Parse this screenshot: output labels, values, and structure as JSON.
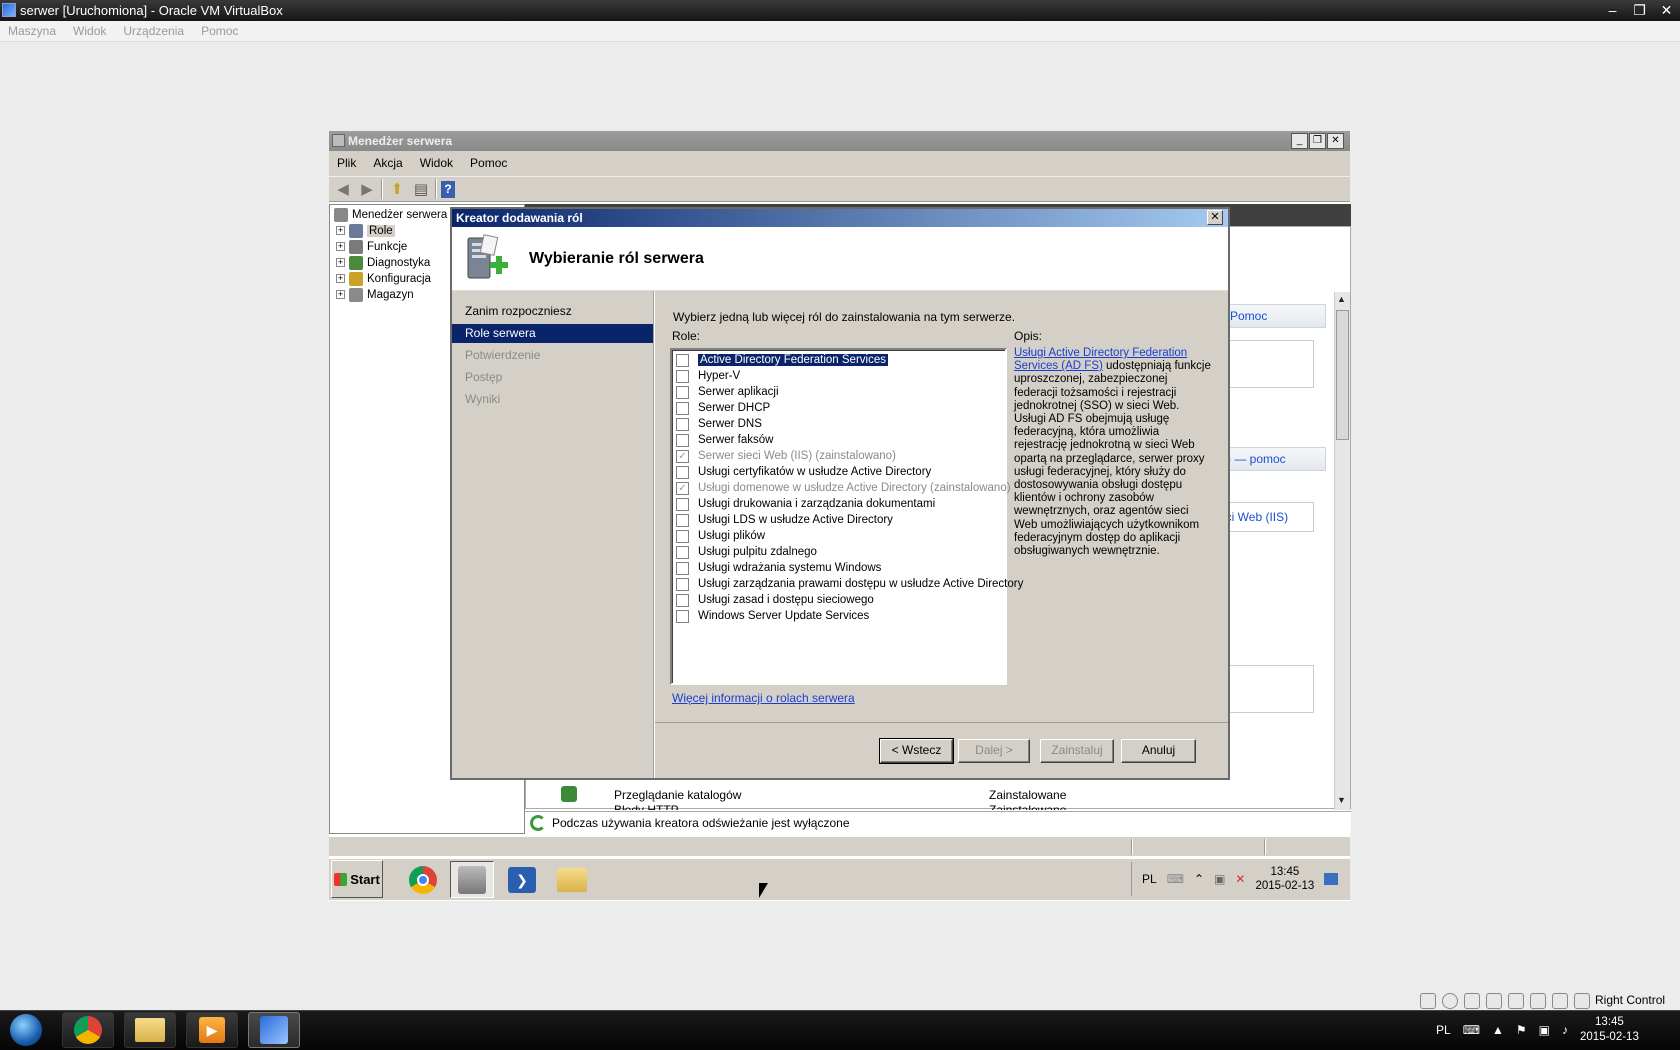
{
  "host": {
    "title": "serwer [Uruchomiona] - Oracle VM VirtualBox",
    "menu": [
      "Maszyna",
      "Widok",
      "Urządzenia",
      "Pomoc"
    ],
    "right_control": "Right Control",
    "tray_lang": "PL",
    "clock_time": "13:45",
    "clock_date": "2015-02-13"
  },
  "server_manager": {
    "title": "Menedżer serwera",
    "menu": [
      "Plik",
      "Akcja",
      "Widok",
      "Pomoc"
    ],
    "tree": {
      "root": "Menedżer serwera (",
      "items": [
        "Role",
        "Funkcje",
        "Diagnostyka",
        "Konfiguracja",
        "Magazyn"
      ]
    },
    "right_pane": {
      "help_link": "Pomoc",
      "help_link2": ") — pomoc",
      "iis_link": "eci Web (IIS)",
      "rows": [
        {
          "name": "Przeglądanie katalogów",
          "status": "Zainstalowane"
        },
        {
          "name": "Błędy HTTP",
          "status": "Zainstalowane"
        }
      ]
    },
    "status_message": "Podczas używania kreatora odświeżanie jest wyłączone"
  },
  "guest_taskbar": {
    "start": "Start",
    "lang": "PL",
    "clock_time": "13:45",
    "clock_date": "2015-02-13"
  },
  "wizard": {
    "title": "Kreator dodawania ról",
    "heading": "Wybieranie ról serwera",
    "steps": [
      "Zanim rozpoczniesz",
      "Role serwera",
      "Potwierdzenie",
      "Postęp",
      "Wyniki"
    ],
    "active_step": 1,
    "instruction": "Wybierz jedną lub więcej ról do zainstalowania na tym serwerze.",
    "roles_label": "Role:",
    "description_label": "Opis:",
    "roles": [
      {
        "label": "Active Directory Federation Services",
        "checked": false,
        "disabled": false,
        "selected": true
      },
      {
        "label": "Hyper-V",
        "checked": false,
        "disabled": false
      },
      {
        "label": "Serwer aplikacji",
        "checked": false,
        "disabled": false
      },
      {
        "label": "Serwer DHCP",
        "checked": false,
        "disabled": false
      },
      {
        "label": "Serwer DNS",
        "checked": false,
        "disabled": false
      },
      {
        "label": "Serwer faksów",
        "checked": false,
        "disabled": false
      },
      {
        "label": "Serwer sieci Web (IIS)  (zainstalowano)",
        "checked": true,
        "disabled": true
      },
      {
        "label": "Usługi certyfikatów w usłudze Active Directory",
        "checked": false,
        "disabled": false
      },
      {
        "label": "Usługi domenowe w usłudze Active Directory  (zainstalowano)",
        "checked": true,
        "disabled": true
      },
      {
        "label": "Usługi drukowania i zarządzania dokumentami",
        "checked": false,
        "disabled": false
      },
      {
        "label": "Usługi LDS w usłudze Active Directory",
        "checked": false,
        "disabled": false
      },
      {
        "label": "Usługi plików",
        "checked": false,
        "disabled": false
      },
      {
        "label": "Usługi pulpitu zdalnego",
        "checked": false,
        "disabled": false
      },
      {
        "label": "Usługi wdrażania systemu Windows",
        "checked": false,
        "disabled": false
      },
      {
        "label": "Usługi zarządzania prawami dostępu w usłudze Active Directory",
        "checked": false,
        "disabled": false
      },
      {
        "label": "Usługi zasad i dostępu sieciowego",
        "checked": false,
        "disabled": false
      },
      {
        "label": "Windows Server Update Services",
        "checked": false,
        "disabled": false
      }
    ],
    "description_link": "Usługi Active Directory Federation Services (AD FS)",
    "description_text": " udostępniają funkcje uproszczonej, zabezpieczonej federacji tożsamości i rejestracji jednokrotnej (SSO) w sieci Web. Usługi AD FS obejmują usługę federacyjną, która umożliwia rejestrację jednokrotną w sieci Web opartą na przeglądarce, serwer proxy usługi federacyjnej, który służy do dostosowywania obsługi dostępu klientów i ochrony zasobów wewnętrznych, oraz agentów sieci Web umożliwiających użytkownikom federacyjnym dostęp do aplikacji obsługiwanych wewnętrznie.",
    "more_info_link": "Więcej informacji o rolach serwera",
    "buttons": {
      "back": "< Wstecz",
      "next": "Dalej >",
      "install": "Zainstaluj",
      "cancel": "Anuluj"
    }
  }
}
